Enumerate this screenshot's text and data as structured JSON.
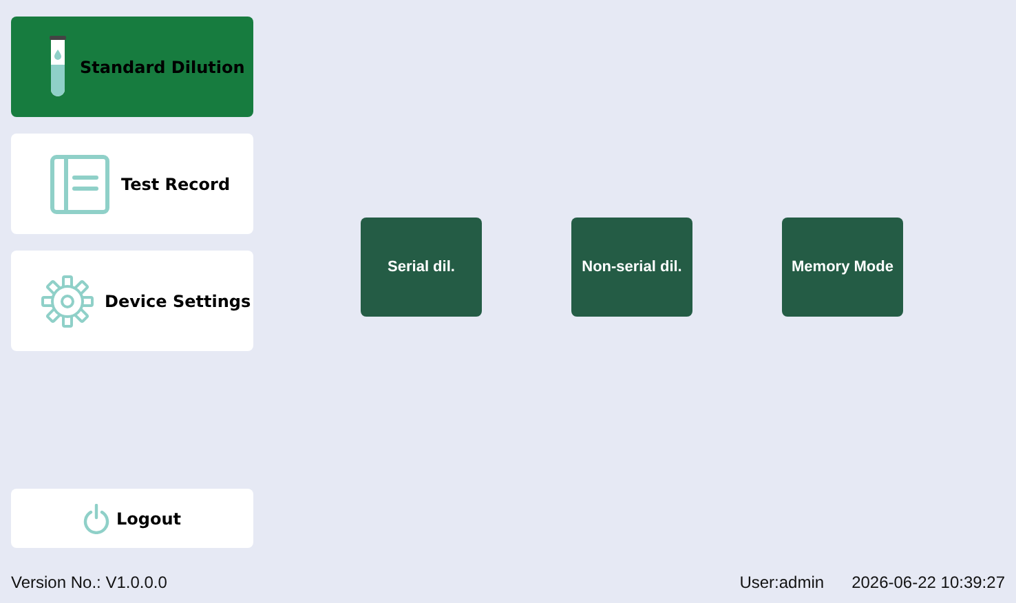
{
  "sidebar": {
    "items": [
      {
        "label": "Standard Dilution",
        "kind": "tube",
        "selected": true
      },
      {
        "label": "Test Record",
        "kind": "book",
        "selected": false
      },
      {
        "label": "Device Settings",
        "kind": "gear",
        "selected": false
      }
    ],
    "logout": {
      "label": "Logout"
    }
  },
  "modes": [
    {
      "label": "Serial dil."
    },
    {
      "label": "Non-serial dil."
    },
    {
      "label": "Memory Mode"
    }
  ],
  "status_bar": {
    "version": "Version No.: V1.0.0.0",
    "user": "User:admin",
    "datetime": "2026-06-22 10:39:27"
  }
}
